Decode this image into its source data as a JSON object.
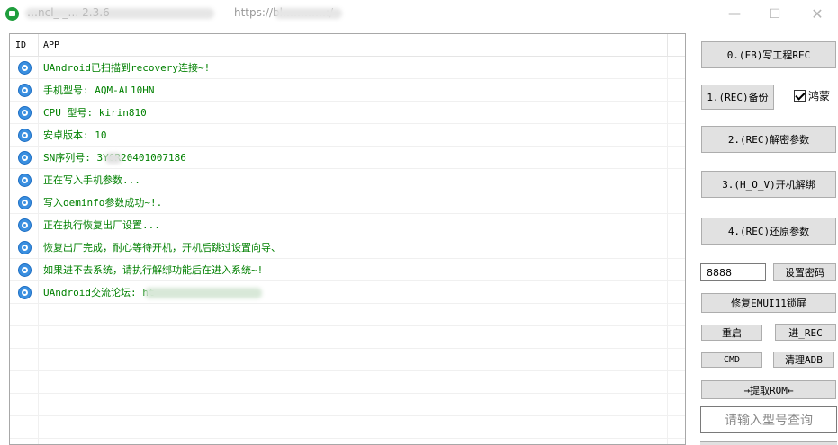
{
  "window": {
    "title_left": "…ncl_ _… 2.3.6",
    "title_url": "https://bl…………:/",
    "minimize_icon": "minimize-icon",
    "maximize_icon": "maximize-icon",
    "close_icon": "close-icon"
  },
  "list": {
    "columns": [
      "ID",
      "APP"
    ],
    "rows": [
      {
        "status_icon": "info-circle-icon",
        "text": "UAndroid已扫描到recovery连接~!"
      },
      {
        "status_icon": "info-circle-icon",
        "text": "手机型号: AQM-AL10HN"
      },
      {
        "status_icon": "info-circle-icon",
        "text": "CPU 型号: kirin810"
      },
      {
        "status_icon": "info-circle-icon",
        "text": "安卓版本: 10"
      },
      {
        "status_icon": "info-circle-icon",
        "text": "SN序列号:  3Y6R20401007186"
      },
      {
        "status_icon": "info-circle-icon",
        "text": "正在写入手机参数..."
      },
      {
        "status_icon": "info-circle-icon",
        "text": "写入oeminfo参数成功~!."
      },
      {
        "status_icon": "info-circle-icon",
        "text": "正在执行恢复出厂设置..."
      },
      {
        "status_icon": "info-circle-icon",
        "text": "恢复出厂完成，耐心等待开机，开机后跳过设置向导、"
      },
      {
        "status_icon": "info-circle-icon",
        "text": "如果进不去系统，请执行解绑功能后在进入系统~!"
      },
      {
        "status_icon": "info-circle-icon",
        "text": "UAndroid交流论坛: ht"
      }
    ]
  },
  "controls": {
    "btn0": "0.(FB)写工程REC",
    "btn1": "1.(REC)备份",
    "hongmeng_label": "鸿蒙",
    "hongmeng_checked": true,
    "btn2": "2.(REC)解密参数",
    "btn3": "3.(H_O_V)开机解绑",
    "btn4": "4.(REC)还原参数",
    "password_value": "8888",
    "set_password": "设置密码",
    "fix_emui": "修复EMUI11锁屏",
    "reboot": "重启",
    "enter_rec": "进_REC",
    "cmd": "CMD",
    "clean_adb": "清理ADB",
    "extract_rom": "→提取ROM←",
    "search_placeholder": "请输入型号查询"
  }
}
